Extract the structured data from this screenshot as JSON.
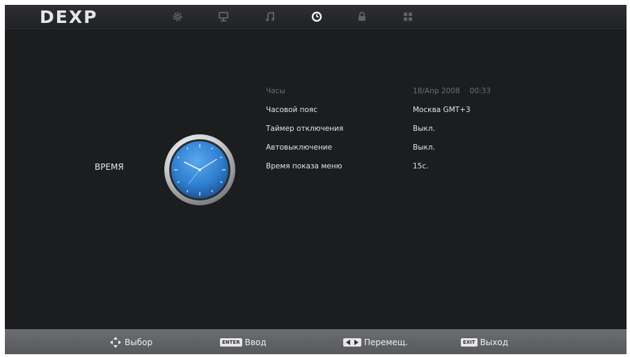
{
  "brand": {
    "logo_text": "DEXP"
  },
  "tabs": [
    {
      "name": "gear-icon",
      "active": false
    },
    {
      "name": "monitor-icon",
      "active": false
    },
    {
      "name": "music-note-icon",
      "active": false
    },
    {
      "name": "clock-icon",
      "active": true
    },
    {
      "name": "lock-icon",
      "active": false
    },
    {
      "name": "grid-icon",
      "active": false
    }
  ],
  "section": {
    "title": "ВРЕМЯ"
  },
  "settings": [
    {
      "label": "Часы",
      "date": "18/Апр 2008",
      "time": "00:33",
      "enabled": false
    },
    {
      "label": "Часовой пояс",
      "value": "Москва GMT+3",
      "enabled": true
    },
    {
      "label": "Таймер отключения",
      "value": "Выкл.",
      "enabled": true
    },
    {
      "label": "Автовыключение",
      "value": "Выкл.",
      "enabled": true
    },
    {
      "label": "Время показа меню",
      "value": "15с.",
      "enabled": true
    }
  ],
  "footer": {
    "select": {
      "label": "Выбор",
      "icon": "dpad-icon"
    },
    "enter": {
      "key": "ENTER",
      "label": "Ввод"
    },
    "move": {
      "label": "Перемещ.",
      "icon": "left-right-arrows-icon"
    },
    "exit": {
      "key": "EXIT",
      "label": "Выход"
    }
  },
  "colors": {
    "background": "#1b1d1f",
    "text": "#e4e4e4",
    "disabled_text": "#6c6f73",
    "clock_face": "#2f7fd0",
    "footer": "#636568"
  }
}
